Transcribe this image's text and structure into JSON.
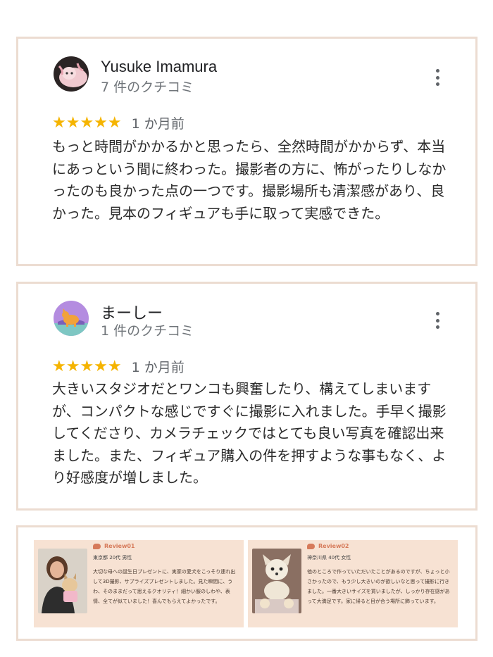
{
  "reviews": [
    {
      "name": "Yusuke Imamura",
      "count": "7 件のクチコミ",
      "stars": "★★★★★",
      "date": "1 か月前",
      "text": "もっと時間がかかるかと思ったら、全然時間がかからず、本当にあっという間に終わった。撮影者の方に、怖がったりしなかったのも良かった点の一つです。撮影場所も清潔感があり、良かった。見本のフィギュアも手に取って実感できた。"
    },
    {
      "name": "まーしー",
      "count": "1 件のクチコミ",
      "stars": "★★★★★",
      "date": "1 か月前",
      "text": "大きいスタジオだとワンコも興奮したり、構えてしまいますが、コンパクトな感じですぐに撮影に入れました。手早く撮影してくださり、カメラチェックではとても良い写真を確認出来ました。また、フィギュア購入の件を押すような事もなく、より好感度が増しました。"
    }
  ],
  "banners": [
    {
      "tag": "Review01",
      "meta": "東京都 20代 男性",
      "text": "大切な母への誕生日プレゼントに、実家の愛犬をこっそり連れ出して3D撮影、サプライズプレゼントしました。見た瞬間に、うわ、そのままだって思えるクオリティ！細かい服のしわや、表情、全てが似ていました！喜んでもらえてよかったです。"
    },
    {
      "tag": "Review02",
      "meta": "神奈川県 40代 女性",
      "text": "他のところで作っていただいたことがあるのですが、ちょっと小さかったので、もう少し大きいのが欲しいなと思って撮影に行きました。一番大きいサイズを買いましたが、しっかり存在感があって大満足です。家に帰ると目が合う場所に飾っています。"
    }
  ],
  "colors": {
    "star": "#f5b400",
    "card_border": "#ecdcd1",
    "banner_bg": "#f7e2d3",
    "tag": "#d67a5a"
  },
  "icons": {
    "menu": "more-vert-icon",
    "rating": "star-icon",
    "tag": "speech-bubble-icon"
  }
}
